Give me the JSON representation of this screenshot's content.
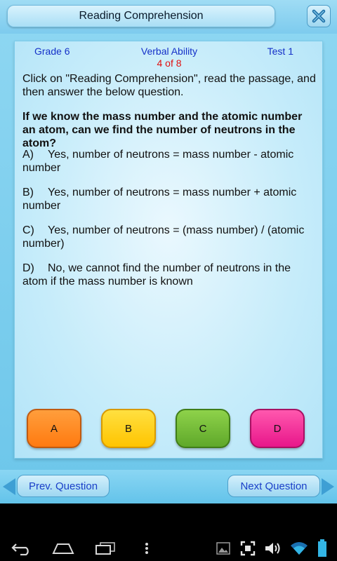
{
  "header": {
    "title": "Reading Comprehension",
    "close_icon": "close-icon"
  },
  "card": {
    "grade": "Grade 6",
    "category": "Verbal Ability",
    "test": "Test 1",
    "progress": "4 of 8",
    "instruction": "Click on \"Reading Comprehension\", read the passage, and then answer the below question.",
    "question": "If we know the mass number and the atomic number an atom, can we find the number of neutrons in the atom?",
    "options": [
      {
        "letter": "A)",
        "text": "Yes, number of neutrons = mass number - atomic number"
      },
      {
        "letter": "B)",
        "text": "Yes, number of neutrons = mass number + atomic number"
      },
      {
        "letter": "C)",
        "text": "Yes, number of neutrons = (mass number) / (atomic number)"
      },
      {
        "letter": "D)",
        "text": "No, we cannot find the number of neutrons in the atom if the mass number is known"
      }
    ]
  },
  "answers": [
    {
      "label": "A",
      "color": "#ff8a1e"
    },
    {
      "label": "B",
      "color": "#ffd21a"
    },
    {
      "label": "C",
      "color": "#72bb36"
    },
    {
      "label": "D",
      "color": "#f0309a"
    }
  ],
  "nav": {
    "prev_label": "Prev. Question",
    "next_label": "Next Question"
  },
  "system_bar": {
    "icons": [
      "back-icon",
      "home-icon",
      "recent-apps-icon",
      "menu-dots-icon",
      "gallery-icon",
      "screenshot-icon",
      "volume-icon",
      "wifi-icon",
      "battery-icon"
    ]
  },
  "colors": {
    "header_text": "#1530c8",
    "progress_text": "#e01010",
    "background": "#7dcbee"
  }
}
